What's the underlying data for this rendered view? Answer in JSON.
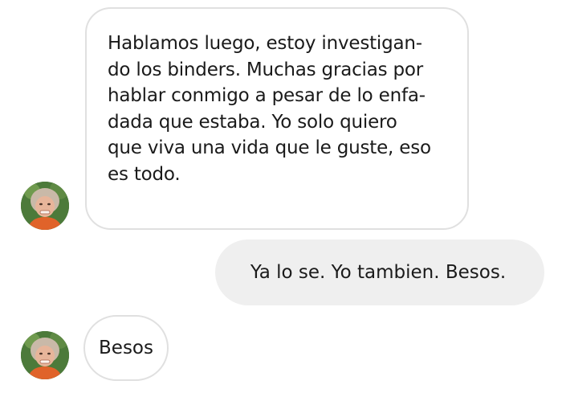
{
  "conversation": {
    "messages": [
      {
        "sender": "incoming",
        "text": "Hablamos luego, estoy investigan-\ndo los binders. Muchas gracias por\nhablar conmigo a pesar de lo enfa-\ndada que estaba. Yo solo quiero\nque viva una vida que le guste, eso\nes todo."
      },
      {
        "sender": "outgoing",
        "text": "Ya lo se. Yo tambien. Besos."
      },
      {
        "sender": "incoming",
        "text": "Besos"
      }
    ]
  },
  "colors": {
    "incoming_bubble_bg": "#ffffff",
    "incoming_bubble_border": "#e0e0e0",
    "outgoing_bubble_bg": "#efefef",
    "text": "#1a1a1a"
  },
  "icons": {
    "avatar": "contact-avatar-photo"
  }
}
